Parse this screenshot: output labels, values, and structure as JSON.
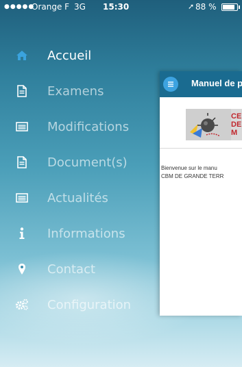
{
  "status_bar": {
    "signal": "●●●●●",
    "carrier": "Orange F",
    "network": "3G",
    "time": "15:30",
    "location": "➚",
    "battery": "88 %"
  },
  "menu": {
    "items": [
      {
        "label": "Accueil",
        "icon": "home-icon"
      },
      {
        "label": "Examens",
        "icon": "document-icon"
      },
      {
        "label": "Modifications",
        "icon": "list-icon"
      },
      {
        "label": "Document(s)",
        "icon": "document-icon"
      },
      {
        "label": "Actualités",
        "icon": "list-icon"
      },
      {
        "label": "Informations",
        "icon": "info-icon"
      },
      {
        "label": "Contact",
        "icon": "location-pin-icon"
      },
      {
        "label": "Configuration",
        "icon": "gears-icon"
      }
    ]
  },
  "panel": {
    "title": "Manuel de p",
    "logo_text": [
      "CE",
      "DE",
      "M"
    ],
    "welcome_lines": [
      "Bienvenue sur le manu",
      "CBM DE GRANDE TERR"
    ]
  },
  "colors": {
    "accent": "#1a6b90",
    "menu_button": "#3da3e0",
    "home_icon": "#3aa3de"
  }
}
